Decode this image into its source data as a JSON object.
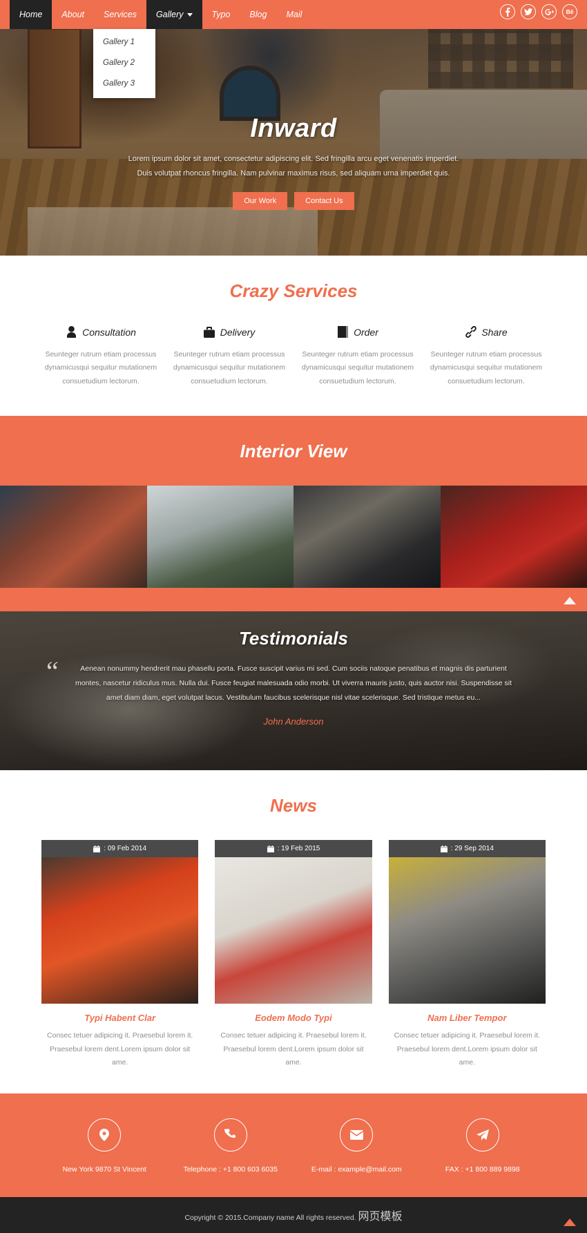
{
  "nav": {
    "items": [
      {
        "label": "Home",
        "active": true,
        "dropdown": false
      },
      {
        "label": "About",
        "active": false,
        "dropdown": false
      },
      {
        "label": "Services",
        "active": false,
        "dropdown": false
      },
      {
        "label": "Gallery",
        "active": false,
        "dropdown": true
      },
      {
        "label": "Typo",
        "active": false,
        "dropdown": false
      },
      {
        "label": "Blog",
        "active": false,
        "dropdown": false
      },
      {
        "label": "Mail",
        "active": false,
        "dropdown": false
      }
    ],
    "dropdown_items": [
      {
        "label": "Gallery 1"
      },
      {
        "label": "Gallery 2"
      },
      {
        "label": "Gallery 3"
      }
    ],
    "socials": [
      {
        "name": "facebook",
        "glyph": "f"
      },
      {
        "name": "twitter",
        "glyph": "✉"
      },
      {
        "name": "google-plus",
        "glyph": "g+"
      },
      {
        "name": "behance",
        "glyph": "Bē"
      }
    ]
  },
  "hero": {
    "title": "Inward",
    "line1": "Lorem ipsum dolor sit amet, consectetur adipiscing elit. Sed fringilla arcu eget venenatis imperdiet.",
    "line2": "Duis volutpat rhoncus fringilla. Nam pulvinar maximus risus, sed aliquam urna imperdiet quis.",
    "btn_primary": "Our Work",
    "btn_secondary": "Contact Us"
  },
  "services": {
    "title": "Crazy Services",
    "items": [
      {
        "name": "Consultation",
        "icon": "user-icon",
        "text": "Seunteger rutrum etiam processus dynamicusqui sequitur mutationem consuetudium lectorum."
      },
      {
        "name": "Delivery",
        "icon": "briefcase-icon",
        "text": "Seunteger rutrum etiam processus dynamicusqui sequitur mutationem consuetudium lectorum."
      },
      {
        "name": "Order",
        "icon": "book-icon",
        "text": "Seunteger rutrum etiam processus dynamicusqui sequitur mutationem consuetudium lectorum."
      },
      {
        "name": "Share",
        "icon": "link-icon",
        "text": "Seunteger rutrum etiam processus dynamicusqui sequitur mutationem consuetudium lectorum."
      }
    ]
  },
  "interior": {
    "title": "Interior View",
    "photos": [
      {
        "alt": "living-room-fireplace"
      },
      {
        "alt": "woman-in-green-armchair"
      },
      {
        "alt": "modern-dark-hallway"
      },
      {
        "alt": "red-sofa-living-room"
      }
    ]
  },
  "testimonials": {
    "title": "Testimonials",
    "quote": "Aenean nonummy hendrerit mau phasellu porta. Fusce suscipit varius mi sed. Cum sociis natoque penatibus et magnis dis parturient montes, nascetur ridiculus mus. Nulla dui. Fusce feugiat malesuada odio morbi. Ut viverra mauris justo, quis auctor nisi. Suspendisse sit amet diam diam, eget volutpat lacus. Vestibulum faucibus scelerisque nisl vitae scelerisque. Sed tristique metus eu...",
    "author": "John Anderson"
  },
  "news": {
    "title": "News",
    "cards": [
      {
        "date": ": 09 Feb 2014",
        "title": "Typi Habent Clar",
        "text": "Consec tetuer adipicing it. Praesebul lorem it. Praesebul lorem dent.Lorem ipsum dolor sit ame.",
        "img_alt": "orange-armchair-reading-room"
      },
      {
        "date": ": 19 Feb 2015",
        "title": "Eodem Modo Typi",
        "text": "Consec tetuer adipicing it. Praesebul lorem it. Praesebul lorem dent.Lorem ipsum dolor sit ame.",
        "img_alt": "white-canopy-bed-bedroom"
      },
      {
        "date": ": 29 Sep 2014",
        "title": "Nam Liber Tempor",
        "text": "Consec tetuer adipicing it. Praesebul lorem it. Praesebul lorem dent.Lorem ipsum dolor sit ame.",
        "img_alt": "modern-kitchen-island"
      }
    ]
  },
  "footer": {
    "contacts": [
      {
        "icon": "location-pin-icon",
        "text": "New York 9870 St Vincent"
      },
      {
        "icon": "phone-icon",
        "text": "Telephone : +1 800 603 6035"
      },
      {
        "icon": "envelope-icon",
        "text": "E-mail : example@mail.com"
      },
      {
        "icon": "paper-plane-icon",
        "text": "FAX : +1 800 889 9898"
      }
    ],
    "copyright": "Copyright © 2015.Company name All rights reserved. ",
    "copyright_link": "网页模板"
  },
  "colors": {
    "accent": "#ef6f4e",
    "dark": "#232323",
    "muted": "#8e8e8e"
  }
}
